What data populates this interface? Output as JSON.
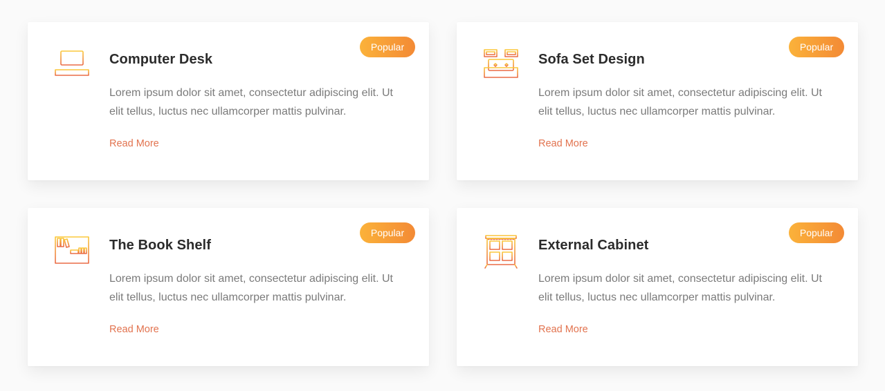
{
  "cards": [
    {
      "title": "Computer Desk",
      "description": "Lorem ipsum dolor sit amet, consectetur adipiscing elit. Ut elit tellus, luctus nec ullamcorper mattis pulvinar.",
      "link": "Read More",
      "badge": "Popular",
      "icon": "computer-desk-icon"
    },
    {
      "title": "Sofa Set Design",
      "description": "Lorem ipsum dolor sit amet, consectetur adipiscing elit. Ut elit tellus, luctus nec ullamcorper mattis pulvinar.",
      "link": "Read More",
      "badge": "Popular",
      "icon": "sofa-icon"
    },
    {
      "title": "The Book Shelf",
      "description": "Lorem ipsum dolor sit amet, consectetur adipiscing elit. Ut elit tellus, luctus nec ullamcorper mattis pulvinar.",
      "link": "Read More",
      "badge": "Popular",
      "icon": "bookshelf-icon"
    },
    {
      "title": "External Cabinet",
      "description": "Lorem ipsum dolor sit amet, consectetur adipiscing elit. Ut elit tellus, luctus nec ullamcorper mattis pulvinar.",
      "link": "Read More",
      "badge": "Popular",
      "icon": "cabinet-icon"
    }
  ],
  "colors": {
    "accent": "#e2734f",
    "gradient_start": "#fbb23a",
    "gradient_end": "#f38a35",
    "title": "#2b2b2b",
    "text": "#7a7a7a"
  }
}
